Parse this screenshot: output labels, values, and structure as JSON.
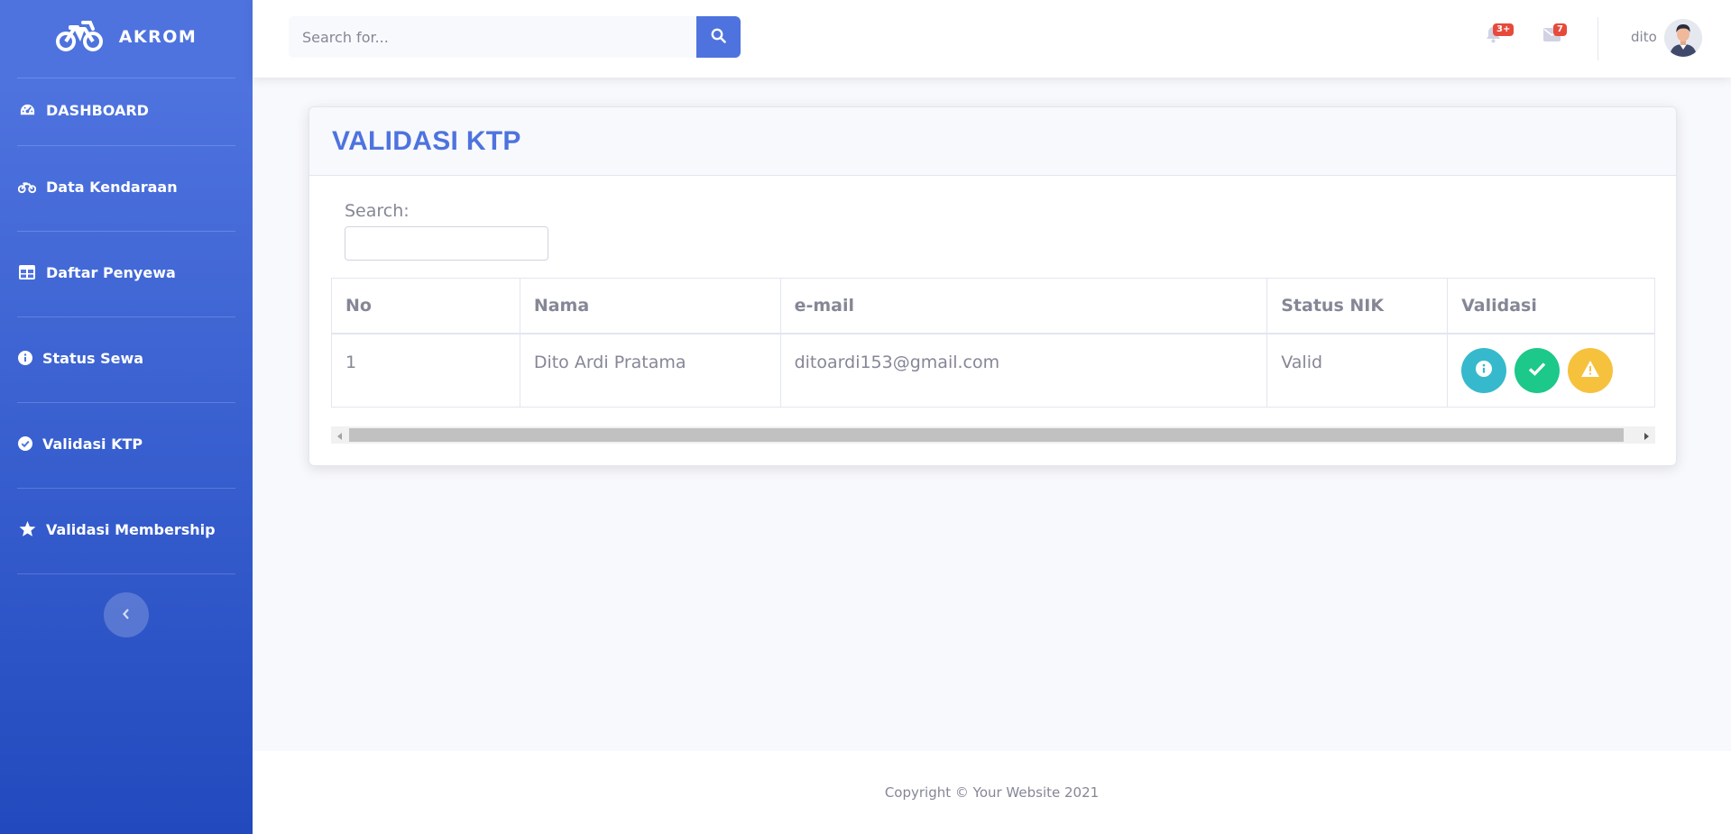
{
  "brand": {
    "name": "AKROM",
    "icon": "motorcycle-icon"
  },
  "sidebar": {
    "items": [
      {
        "label": "DASHBOARD",
        "icon": "tachometer-icon"
      },
      {
        "label": "Data Kendaraan",
        "icon": "motorcycle-icon"
      },
      {
        "label": "Daftar Penyewa",
        "icon": "table-icon"
      },
      {
        "label": "Status Sewa",
        "icon": "info-circle-icon"
      },
      {
        "label": "Validasi KTP",
        "icon": "check-circle-icon"
      },
      {
        "label": "Validasi Membership",
        "icon": "star-icon"
      }
    ],
    "toggle_icon": "chevron-left-icon"
  },
  "topbar": {
    "search_placeholder": "Search for...",
    "alerts_badge": "3+",
    "messages_badge": "7",
    "user_name": "dito"
  },
  "card": {
    "title": "VALIDASI KTP",
    "search_label": "Search:",
    "table": {
      "headers": [
        "No",
        "Nama",
        "e-mail",
        "Status NIK",
        "Validasi"
      ],
      "rows": [
        {
          "no": "1",
          "nama": "Dito Ardi Pratama",
          "email": "ditoardi153@gmail.com",
          "status": "Valid"
        }
      ]
    }
  },
  "footer": {
    "text": "Copyright © Your Website 2021"
  },
  "colors": {
    "primary": "#4e73df",
    "info": "#36b9cc",
    "success": "#1cc88a",
    "warning": "#f6c23e",
    "danger": "#e74a3b"
  }
}
